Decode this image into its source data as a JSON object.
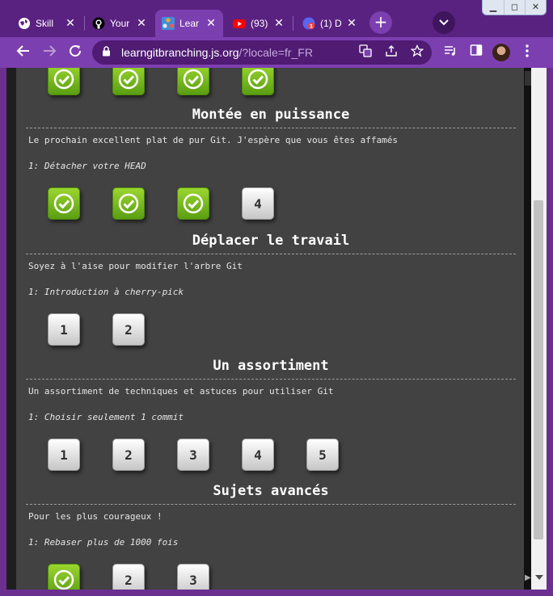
{
  "browser": {
    "tabs": [
      {
        "title": "Skill",
        "favicon": "globe-icon",
        "active": false
      },
      {
        "title": "Your",
        "favicon": "github-icon",
        "active": false
      },
      {
        "title": "Lear",
        "favicon": "learngitbranching-icon",
        "active": true
      },
      {
        "title": "(93)",
        "favicon": "youtube-icon",
        "active": false
      },
      {
        "title": "(1) D",
        "favicon": "discord-icon",
        "active": false
      }
    ],
    "url_host": "learngitbranching.js.org",
    "url_path": "/?locale=fr_FR",
    "theme_color": "#7c3fb0"
  },
  "sections": [
    {
      "title": "",
      "description": "",
      "subtitle": "",
      "levels": [
        {
          "label": "",
          "done": true
        },
        {
          "label": "",
          "done": true
        },
        {
          "label": "",
          "done": true
        },
        {
          "label": "",
          "done": true
        }
      ]
    },
    {
      "title": "Montée en puissance",
      "description": "Le prochain excellent plat de pur Git. J'espère que vous êtes affamés",
      "subtitle": "1: Détacher votre HEAD",
      "levels": [
        {
          "label": "",
          "done": true
        },
        {
          "label": "",
          "done": true
        },
        {
          "label": "",
          "done": true
        },
        {
          "label": "4",
          "done": false
        }
      ]
    },
    {
      "title": "Déplacer le travail",
      "description": "Soyez à l'aise pour modifier l'arbre Git",
      "subtitle": "1: Introduction à cherry-pick",
      "levels": [
        {
          "label": "1",
          "done": false
        },
        {
          "label": "2",
          "done": false
        }
      ]
    },
    {
      "title": "Un assortiment",
      "description": "Un assortiment de techniques et astuces pour utiliser Git",
      "subtitle": "1: Choisir seulement 1 commit",
      "levels": [
        {
          "label": "1",
          "done": false
        },
        {
          "label": "2",
          "done": false
        },
        {
          "label": "3",
          "done": false
        },
        {
          "label": "4",
          "done": false
        },
        {
          "label": "5",
          "done": false
        }
      ]
    },
    {
      "title": "Sujets avancés",
      "description": "Pour les plus courageux !",
      "subtitle": "1: Rebaser plus de 1000 fois",
      "levels": [
        {
          "label": "",
          "done": true
        },
        {
          "label": "2",
          "done": false
        },
        {
          "label": "3",
          "done": false
        }
      ]
    }
  ],
  "colors": {
    "panel_bg": "#424242",
    "level_done": "#7cbf1e",
    "level_todo": "#e6e6e6"
  }
}
